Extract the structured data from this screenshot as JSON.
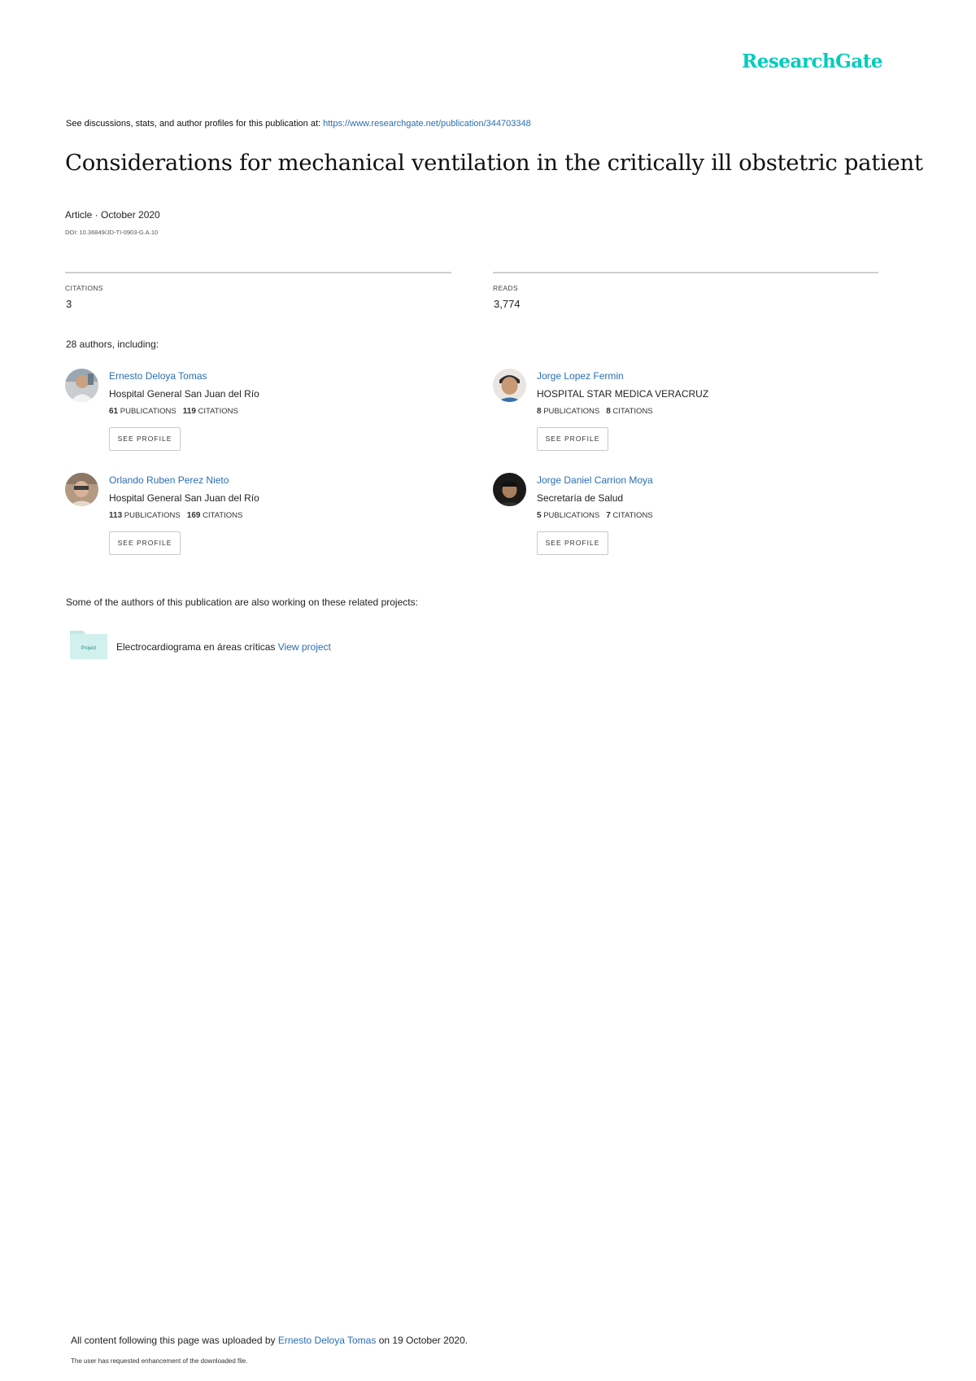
{
  "header": {
    "logo_text": "ResearchGate",
    "logo_color": "#00ccbb"
  },
  "source": {
    "prefix": "See discussions, stats, and author profiles for this publication at: ",
    "url": "https://www.researchgate.net/publication/344703348"
  },
  "publication": {
    "title": "Considerations for mechanical ventilation in the critically ill obstetric patient",
    "type_date": "Article · October 2020",
    "doi": "DOI: 10.36849/JD-TI-0903-G.A.10"
  },
  "stats": {
    "citations_label": "CITATIONS",
    "citations_value": "3",
    "reads_label": "READS",
    "reads_value": "3,774"
  },
  "authors_intro": "28 authors, including:",
  "authors": [
    {
      "name": "Ernesto Deloya Tomas",
      "institution": "Hospital General San Juan del Río",
      "publications": "61",
      "citations": "119",
      "publications_label": "PUBLICATIONS",
      "citations_label": "CITATIONS",
      "button": "SEE PROFILE"
    },
    {
      "name": "Jorge Lopez Fermin",
      "institution": "HOSPITAL STAR MEDICA VERACRUZ",
      "publications": "8",
      "citations": "8",
      "publications_label": "PUBLICATIONS",
      "citations_label": "CITATIONS",
      "button": "SEE PROFILE"
    },
    {
      "name": "Orlando Ruben Perez Nieto",
      "institution": "Hospital General San Juan del Río",
      "publications": "113",
      "citations": "169",
      "publications_label": "PUBLICATIONS",
      "citations_label": "CITATIONS",
      "button": "SEE PROFILE"
    },
    {
      "name": "Jorge Daniel Carrion Moya",
      "institution": "Secretaría de Salud",
      "publications": "5",
      "citations": "7",
      "publications_label": "PUBLICATIONS",
      "citations_label": "CITATIONS",
      "button": "SEE PROFILE"
    }
  ],
  "projects": {
    "heading": "Some of the authors of this publication are also working on these related projects:",
    "items": [
      {
        "icon_label": "Project",
        "name": "Electrocardiograma en áreas críticas ",
        "link": "View project"
      }
    ]
  },
  "footer": {
    "upload_prefix": "All content following this page was uploaded by ",
    "uploader": "Ernesto Deloya Tomas",
    "upload_suffix": " on 19 October 2020.",
    "note": "The user has requested enhancement of the downloaded file."
  }
}
